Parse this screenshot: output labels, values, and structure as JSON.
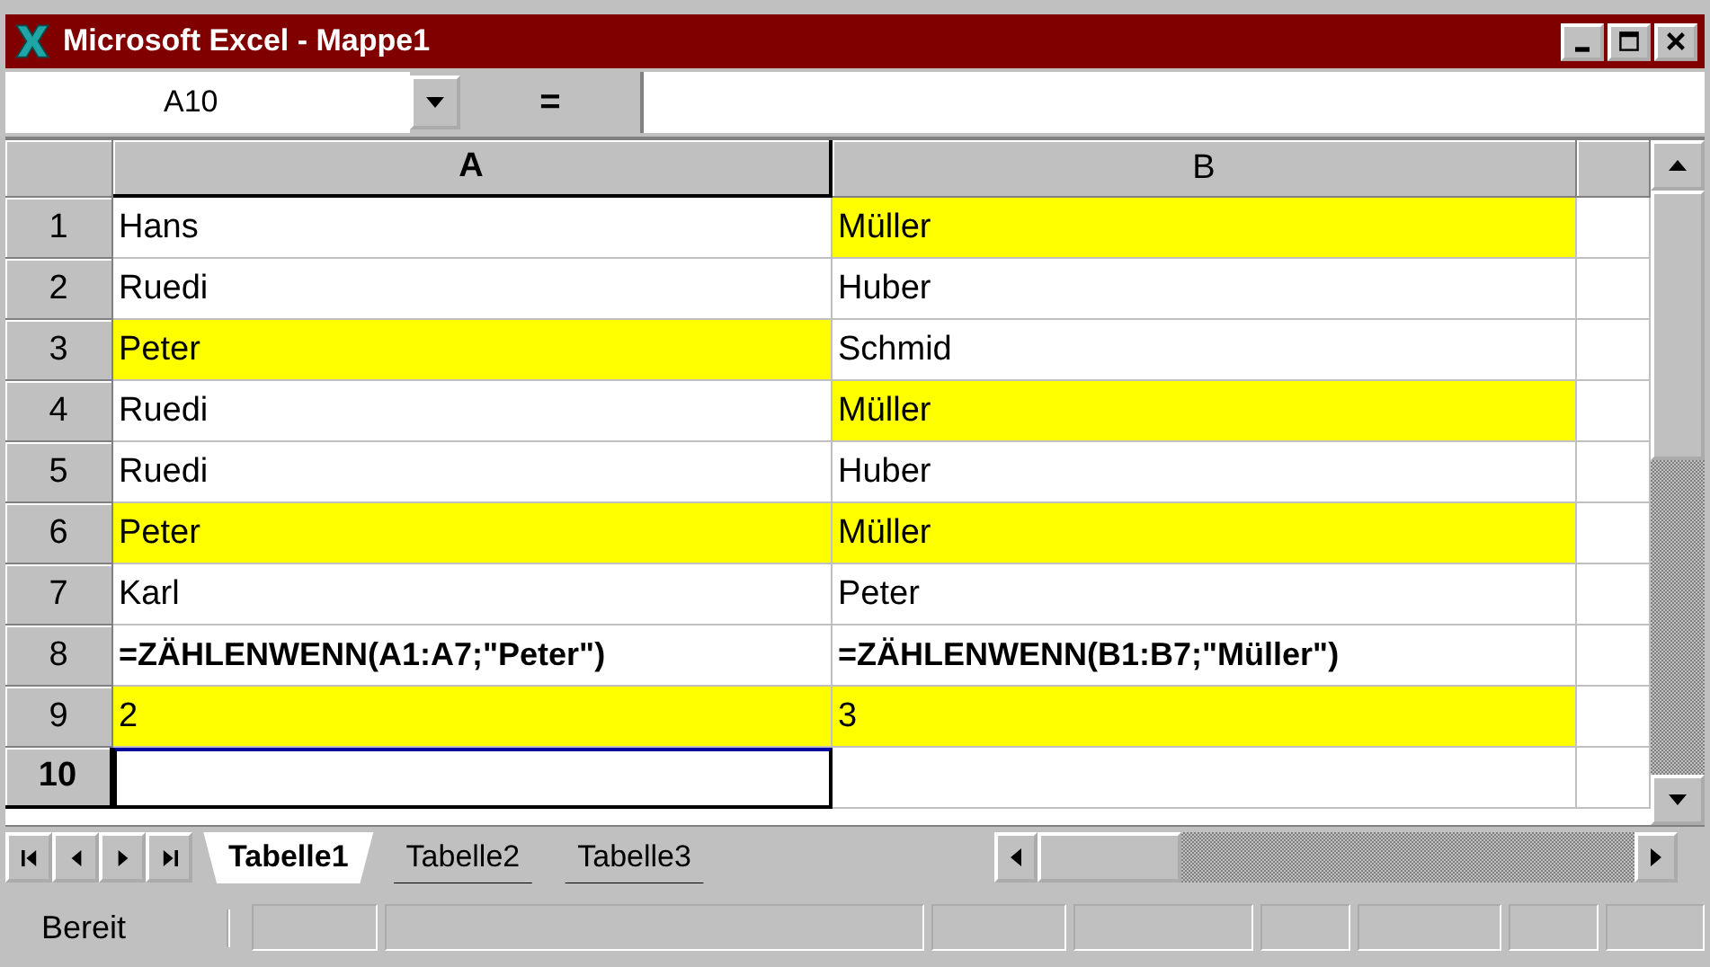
{
  "window": {
    "title": "Microsoft Excel - Mappe1"
  },
  "formula_bar": {
    "name_box": "A10",
    "equals": "="
  },
  "columns": [
    {
      "label": "A",
      "active": true
    },
    {
      "label": "B",
      "active": false
    }
  ],
  "rows": [
    {
      "label": "1",
      "active": false,
      "cells": [
        {
          "text": "Hans",
          "highlight": false,
          "bold": false,
          "selected": false
        },
        {
          "text": "Müller",
          "highlight": true,
          "bold": false,
          "selected": false
        }
      ]
    },
    {
      "label": "2",
      "active": false,
      "cells": [
        {
          "text": "Ruedi",
          "highlight": false,
          "bold": false,
          "selected": false
        },
        {
          "text": "Huber",
          "highlight": false,
          "bold": false,
          "selected": false
        }
      ]
    },
    {
      "label": "3",
      "active": false,
      "cells": [
        {
          "text": "Peter",
          "highlight": true,
          "bold": false,
          "selected": false
        },
        {
          "text": "Schmid",
          "highlight": false,
          "bold": false,
          "selected": false
        }
      ]
    },
    {
      "label": "4",
      "active": false,
      "cells": [
        {
          "text": "Ruedi",
          "highlight": false,
          "bold": false,
          "selected": false
        },
        {
          "text": "Müller",
          "highlight": true,
          "bold": false,
          "selected": false
        }
      ]
    },
    {
      "label": "5",
      "active": false,
      "cells": [
        {
          "text": "Ruedi",
          "highlight": false,
          "bold": false,
          "selected": false
        },
        {
          "text": "Huber",
          "highlight": false,
          "bold": false,
          "selected": false
        }
      ]
    },
    {
      "label": "6",
      "active": false,
      "cells": [
        {
          "text": "Peter",
          "highlight": true,
          "bold": false,
          "selected": false
        },
        {
          "text": "Müller",
          "highlight": true,
          "bold": false,
          "selected": false
        }
      ]
    },
    {
      "label": "7",
      "active": false,
      "cells": [
        {
          "text": "Karl",
          "highlight": false,
          "bold": false,
          "selected": false
        },
        {
          "text": "Peter",
          "highlight": false,
          "bold": false,
          "selected": false
        }
      ]
    },
    {
      "label": "8",
      "active": false,
      "cells": [
        {
          "text": "=ZÄHLENWENN(A1:A7;\"Peter\")",
          "highlight": false,
          "bold": true,
          "selected": false
        },
        {
          "text": "=ZÄHLENWENN(B1:B7;\"Müller\")",
          "highlight": false,
          "bold": true,
          "selected": false
        }
      ]
    },
    {
      "label": "9",
      "active": false,
      "cells": [
        {
          "text": "2",
          "highlight": true,
          "bold": false,
          "selected": false
        },
        {
          "text": "3",
          "highlight": true,
          "bold": false,
          "selected": false
        }
      ]
    },
    {
      "label": "10",
      "active": true,
      "cells": [
        {
          "selected": true
        },
        {
          "selected": false
        }
      ]
    }
  ],
  "sheet_tabs": [
    {
      "label": "Tabelle1",
      "selected": true
    },
    {
      "label": "Tabelle2",
      "selected": false
    },
    {
      "label": "Tabelle3",
      "selected": false
    }
  ],
  "status_bar": {
    "text": "Bereit"
  }
}
